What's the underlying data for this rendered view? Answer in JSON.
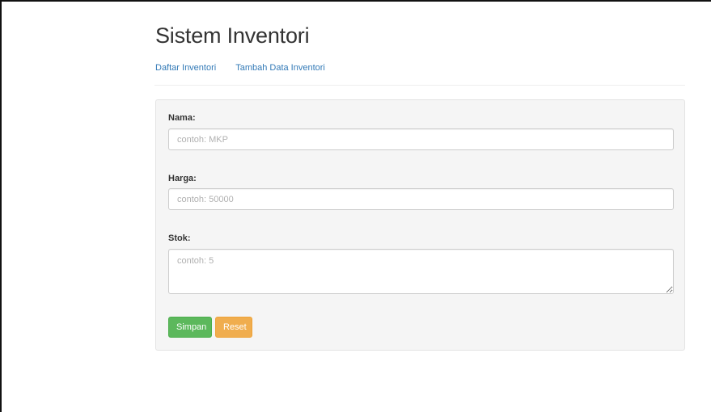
{
  "header": {
    "title": "Sistem Inventori"
  },
  "nav": {
    "items": [
      {
        "label": "Daftar Inventori"
      },
      {
        "label": "Tambah Data Inventori"
      }
    ]
  },
  "form": {
    "nama": {
      "label": "Nama:",
      "placeholder": "contoh: MKP",
      "value": ""
    },
    "harga": {
      "label": "Harga:",
      "placeholder": "contoh: 50000",
      "value": ""
    },
    "stok": {
      "label": "Stok:",
      "placeholder": "contoh: 5",
      "value": ""
    },
    "buttons": {
      "save_label": "Simpan",
      "reset_label": "Reset"
    }
  },
  "colors": {
    "link": "#337ab7",
    "save_button": "#5cb85c",
    "reset_button": "#f0ad4e",
    "well_background": "#f5f5f5"
  }
}
